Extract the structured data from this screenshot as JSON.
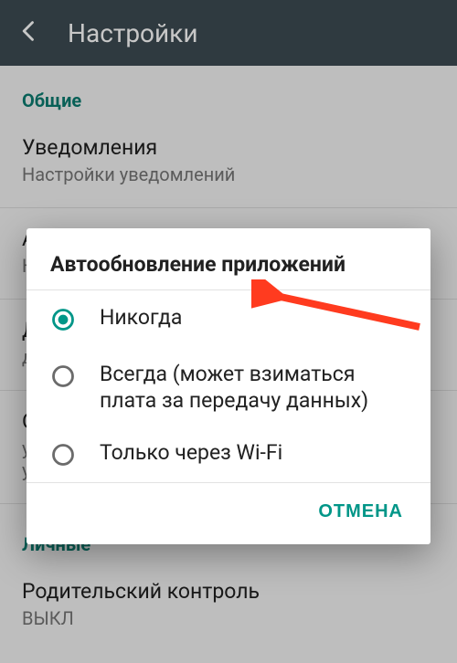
{
  "colors": {
    "accent": "#009688",
    "toolbar": "#3d4b52",
    "arrow": "#ff3b1f"
  },
  "toolbar": {
    "title": "Настройки"
  },
  "sections": {
    "general": {
      "header": "Общие",
      "notifications": {
        "title": "Уведомления",
        "subtitle": "Настройки уведомлений"
      },
      "autoupdate_bg": {
        "title_initial": "А",
        "subtitle_initial": "Н"
      },
      "row_d": {
        "title_initial": "Д",
        "subtitle_initial": "д"
      },
      "row_o": {
        "title_initial": "О",
        "subtitle_line1_initial": "у",
        "subtitle_line2_initial": "у"
      }
    },
    "personal": {
      "header": "Личные",
      "parental": {
        "title": "Родительский контроль",
        "subtitle": "ВЫКЛ"
      }
    }
  },
  "dialog": {
    "title": "Автообновление приложений",
    "options": [
      {
        "label": "Никогда",
        "selected": true
      },
      {
        "label": "Всегда (может взиматься плата за передачу данных)",
        "selected": false
      },
      {
        "label": "Только через Wi-Fi",
        "selected": false
      }
    ],
    "cancel": "ОТМЕНА"
  }
}
